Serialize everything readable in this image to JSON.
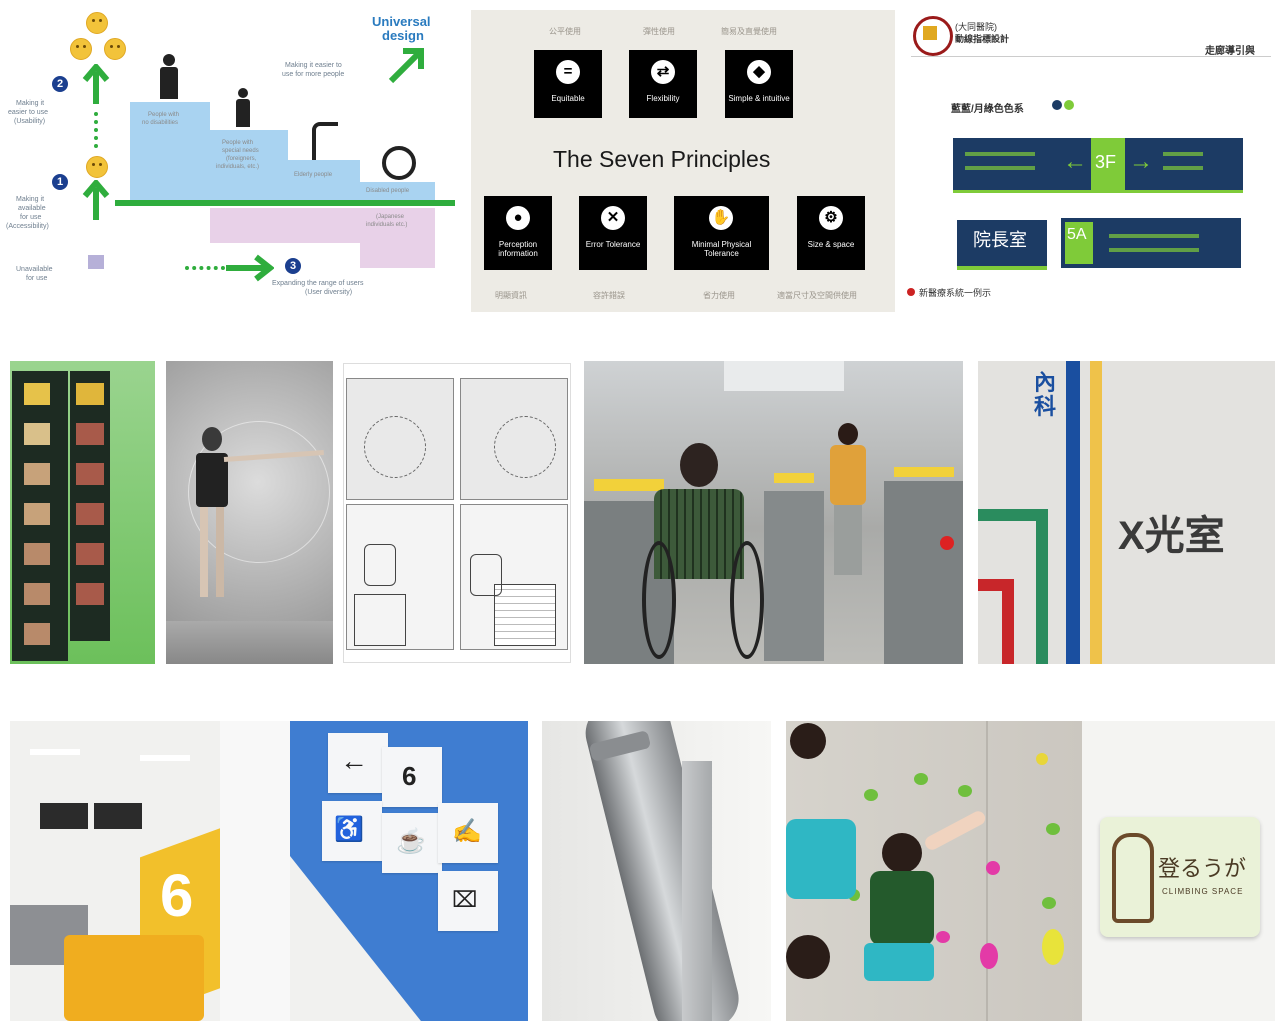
{
  "tile1": {
    "title_line1": "Universal",
    "title_line2": "design",
    "easier_note_line1": "Making it easier to",
    "easier_note_line2": "use for more people",
    "step2_line1": "Making it",
    "step2_line2": "easier to use",
    "step2_line3": "(Usability)",
    "step1_line1": "Making it",
    "step1_line2": "available",
    "step1_line3": "for use",
    "step1_line4": "(Accessibility)",
    "unavailable_line1": "Unavailable",
    "unavailable_line2": "for use",
    "expand_line1": "Expanding the range of users",
    "expand_line2": "(User diversity)",
    "n1": "1",
    "n2": "2",
    "n3": "3",
    "stair1_line1": "People with",
    "stair1_line2": "no disabilities",
    "stair2_line1": "People with",
    "stair2_line2": "special needs",
    "stair2_line3": "(foreigners,",
    "stair2_line4": "individuals, etc.)",
    "stair3": "Elderly people",
    "stair4": "Disabled people",
    "stair5_line1": "(Japanese",
    "stair5_line2": "individuals etc.)"
  },
  "tile2": {
    "title": "The Seven Principles",
    "principles": [
      "Equitable",
      "Flexibility",
      "Simple & intuitive",
      "Perception information",
      "Error Tolerance",
      "Minimal Physical Tolerance",
      "Size & space"
    ],
    "top_cn": [
      "公平使用",
      "彈性使用",
      "簡易及直覺使用"
    ],
    "bottom_cn": [
      "明顯資訊",
      "容許錯誤",
      "省力使用",
      "適當尺寸及空間供使用"
    ]
  },
  "tile3": {
    "org_line1": "(大同醫院)",
    "org_line2": "動線指標設計",
    "header_right": "走廊導引與",
    "color_label": "藍藍/月綠色色系",
    "floor": "3F",
    "room_name": "院長室",
    "room_number": "5A",
    "footer": "新醫療系統一例示"
  },
  "tile8": {
    "char1": "內",
    "char2": "科",
    "room": "X光室"
  },
  "tile9": {
    "number_big": "6",
    "sign_number": "6"
  },
  "tile11": {
    "sign_jp": "登るうが",
    "sign_en": "CLIMBING SPACE"
  },
  "colors": {
    "stair_blue": "#a9d3f1",
    "stair_pink": "#e8d1e8",
    "arrow_green": "#2fad3d",
    "navy_sign": "#1c3b64",
    "sign_green": "#7fcb39",
    "wall_blue": "#3f7dd1",
    "sofa_yellow": "#f0ad1f"
  }
}
